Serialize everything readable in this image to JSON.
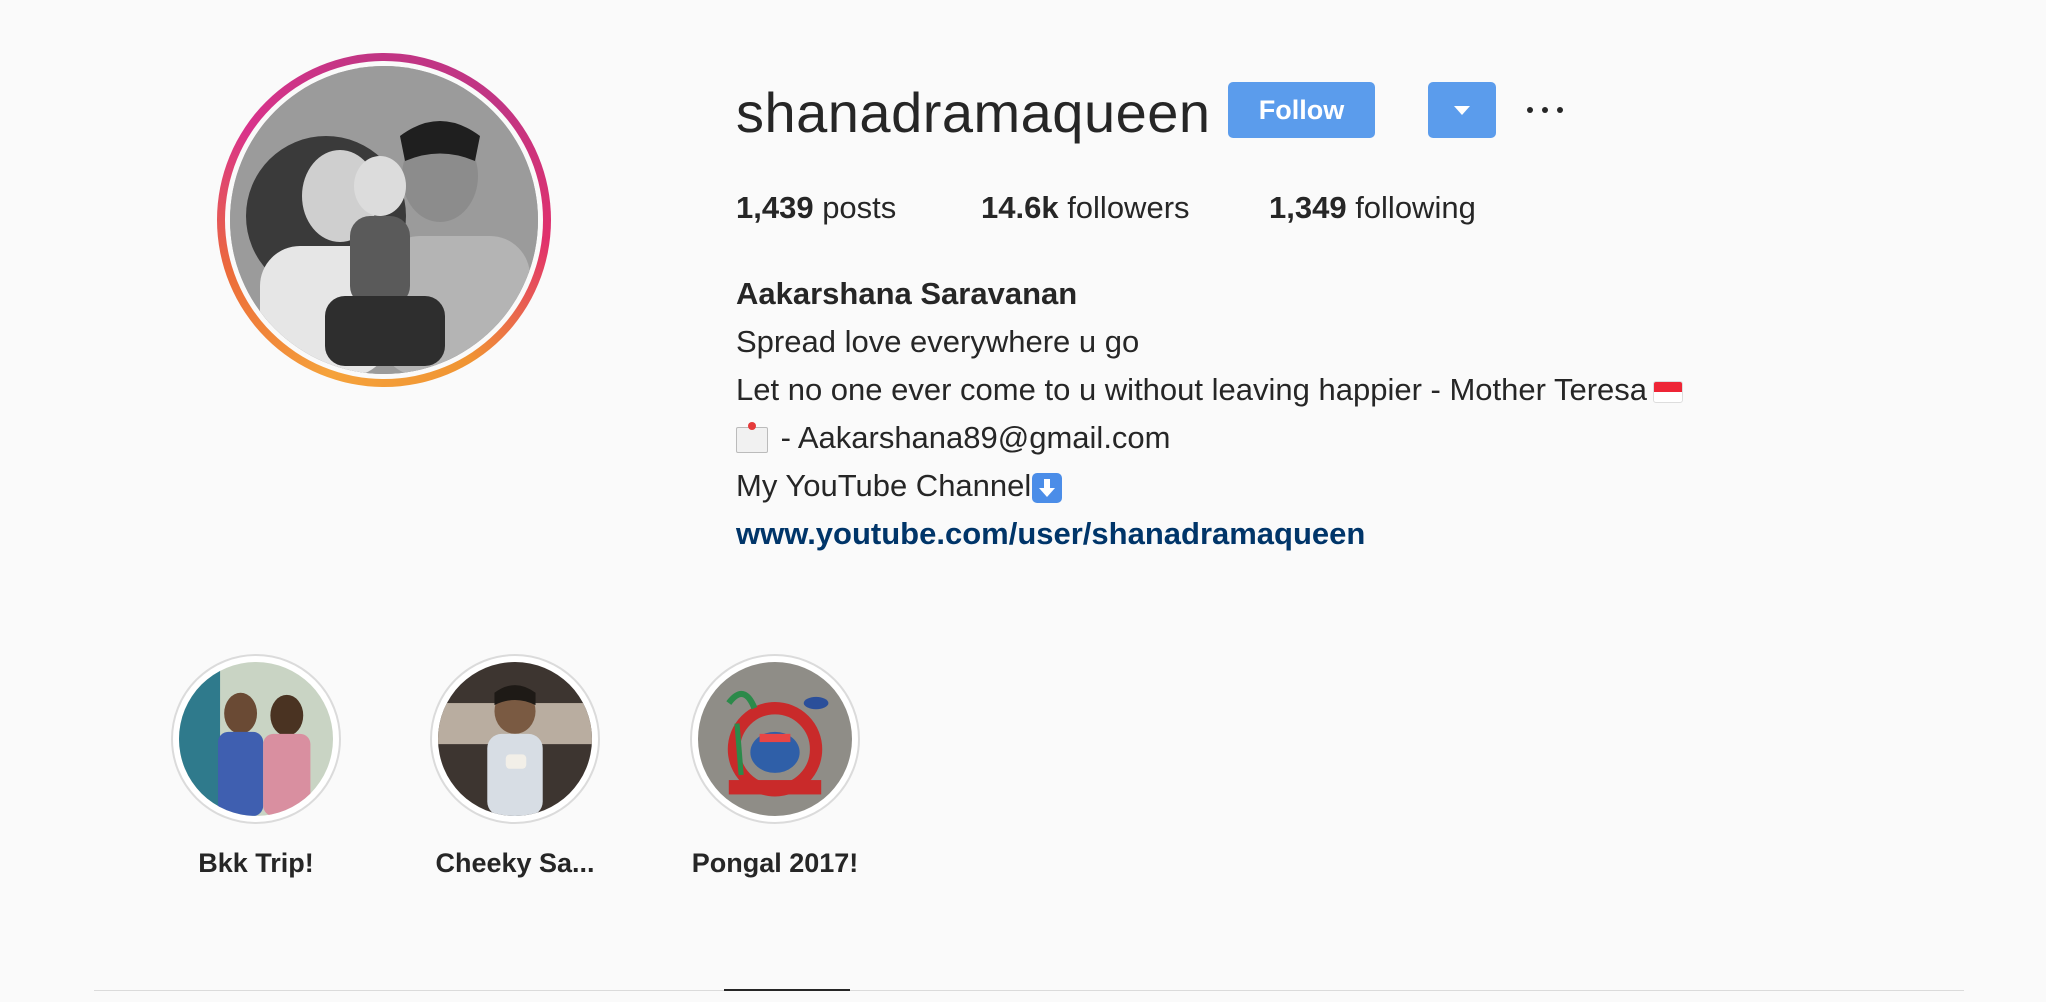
{
  "profile": {
    "username": "shanadramaqueen",
    "follow_label": "Follow",
    "stats": {
      "posts_count": "1,439",
      "posts_label": " posts",
      "followers_count": "14.6k",
      "followers_label": " followers",
      "following_count": "1,349",
      "following_label": " following"
    },
    "bio": {
      "full_name": "Aakarshana Saravanan",
      "line1": "Spread love everywhere u go",
      "line2": "Let no one ever come to u without leaving happier - Mother Teresa",
      "line3": " - Aakarshana89@gmail.com",
      "line4": "My YouTube Channel",
      "link": "www.youtube.com/user/shanadramaqueen"
    }
  },
  "highlights": [
    {
      "label": "Bkk Trip!"
    },
    {
      "label": "Cheeky Sa..."
    },
    {
      "label": "Pongal 2017!"
    }
  ],
  "colors": {
    "accent": "#5b9cec",
    "link": "#003569",
    "background": "#fafafa",
    "text": "#262626"
  }
}
